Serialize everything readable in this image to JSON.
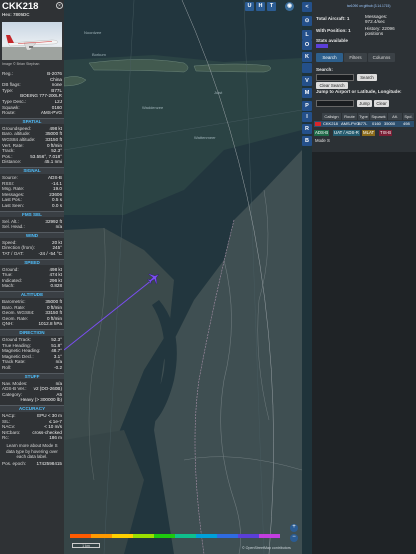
{
  "aircraft": {
    "callsign": "CKK218",
    "hex_label": "Hex: 7805DC",
    "photo_credit": "Image © Brian Stephan",
    "close_icon": "close-icon",
    "details": [
      {
        "k": "Reg.:",
        "v": "B-2076"
      },
      {
        "k": "",
        "v": "China"
      },
      {
        "k": "DB flags:",
        "v": "none"
      },
      {
        "k": "Type:",
        "v": "B77L"
      },
      {
        "k": "",
        "v": "BOEING 777-200LR"
      },
      {
        "k": "Type Desc.:",
        "v": "L2J"
      },
      {
        "k": "Squawk:",
        "v": "0160"
      },
      {
        "k": "Route:",
        "v": "AMS-PVG"
      }
    ]
  },
  "sections": {
    "spatial": {
      "title": "SPATIAL",
      "rows": [
        {
          "k": "Groundspeed:",
          "v": "498 kt"
        },
        {
          "k": "Baro. altitude:",
          "v": "35000 ft"
        },
        {
          "k": "WGS84 altitude:",
          "v": "33150 ft"
        },
        {
          "k": "Vert. Rate:",
          "v": "0 ft/min"
        },
        {
          "k": "Track:",
          "v": "52.3°"
        },
        {
          "k": "Pos.:",
          "v": "53.556°, 7.018°"
        },
        {
          "k": "Distance:",
          "v": "45.1 nmi"
        }
      ]
    },
    "signal": {
      "title": "SIGNAL",
      "rows": [
        {
          "k": "Source:",
          "v": "ADS-B"
        },
        {
          "k": "RSSI:",
          "v": "-14.1"
        },
        {
          "k": "Msg. Rate:",
          "v": "19.0"
        },
        {
          "k": "Messages:",
          "v": "23606"
        },
        {
          "k": "Last Pos.:",
          "v": "0.5 s"
        },
        {
          "k": "Last Seen:",
          "v": "0.0 s"
        }
      ]
    },
    "fms": {
      "title": "FMS SEL",
      "rows": [
        {
          "k": "Sel. Alt.:",
          "v": "32992 ft"
        },
        {
          "k": "Sel. Head.:",
          "v": "n/a"
        }
      ]
    },
    "wind": {
      "title": "WIND",
      "rows": [
        {
          "k": "Speed:",
          "v": "20 kt"
        },
        {
          "k": "Direction (from):",
          "v": "245°"
        },
        {
          "k": "TAT / OAT:",
          "v": "-24 / -54 °C"
        }
      ]
    },
    "speed": {
      "title": "SPEED",
      "rows": [
        {
          "k": "Ground:",
          "v": "498 kt"
        },
        {
          "k": "True:",
          "v": "474 kt"
        },
        {
          "k": "Indicated:",
          "v": "296 kt"
        },
        {
          "k": "Mach:",
          "v": "0.828"
        }
      ]
    },
    "altitude": {
      "title": "ALTITUDE",
      "rows": [
        {
          "k": "Barometric:",
          "v": "35000 ft"
        },
        {
          "k": "Baro. Rate:",
          "v": "0 ft/min"
        },
        {
          "k": "Geom. WGS84:",
          "v": "33150 ft"
        },
        {
          "k": "Geom. Rate:",
          "v": "0 ft/min"
        },
        {
          "k": "QNH:",
          "v": "1012.8 hPa"
        }
      ]
    },
    "direction": {
      "title": "DIRECTION",
      "rows": [
        {
          "k": "Ground Track:",
          "v": "52.3°"
        },
        {
          "k": "True Heading:",
          "v": "51.8°"
        },
        {
          "k": "Magnetic Heading:",
          "v": "48.7°"
        },
        {
          "k": "Magnetic Decl.:",
          "v": "3.1°"
        },
        {
          "k": "Track Rate:",
          "v": "n/a"
        },
        {
          "k": "Roll:",
          "v": "-0.2"
        }
      ]
    },
    "stuff": {
      "title": "STUFF",
      "rows": [
        {
          "k": "Nav. Modes:",
          "v": "n/a"
        },
        {
          "k": "ADS-B Ver.:",
          "v": "v2 (DO-260B)"
        },
        {
          "k": "Category:",
          "v": "A5"
        },
        {
          "k": "",
          "v": "Heavy (> 300000 lb)"
        }
      ]
    },
    "accuracy": {
      "title": "ACCURACY",
      "rows": [
        {
          "k": "NACp:",
          "v": "EPU < 30 m"
        },
        {
          "k": "SIL:",
          "v": "≤ 1e-7"
        },
        {
          "k": "NACv:",
          "v": "< 10 m/s"
        },
        {
          "k": "NICbaro:",
          "v": "cross-checked"
        },
        {
          "k": "Rc:",
          "v": "186 m"
        }
      ]
    },
    "learn_more": "Learn more about Mode S data type by hovering over each data label.",
    "position_epoch": {
      "k": "Pos. epoch:",
      "v": "1742598415"
    }
  },
  "map": {
    "labels": {
      "waddenzee": "Waddenzee",
      "island_a": "Borkum",
      "island_b": "Juist",
      "sea_label": "Noordzee",
      "wz2": "Wattenmeer"
    },
    "top_buttons": [
      "U",
      "H",
      "T"
    ],
    "zoom_in": "+",
    "zoom_out": "−",
    "copyright": "© OpenStreetMap contributors",
    "scale_label": "1 km",
    "altitude_scale_colors": [
      "#ff5a00",
      "#ff9900",
      "#ffd000",
      "#9ae000",
      "#1ec90e",
      "#0fbf8c",
      "#00a0d8",
      "#2f6be0",
      "#5b3fd8",
      "#c33ee0"
    ],
    "icons": {
      "aircraft": "aircraft-icon",
      "layers": "layers-icon",
      "settings": "gear-icon"
    }
  },
  "strip_buttons": [
    "<",
    "⊙",
    "L",
    "O",
    "K",
    "",
    "V",
    "M",
    "P",
    "I",
    "R",
    "B"
  ],
  "right_panel": {
    "header_link": "tar1090 on github (3.14.1715)",
    "total_label": "Total Aircraft: 1",
    "messages_label": "Messages:",
    "messages_value": "972.4/sec",
    "with_position_label": "With Position: 1",
    "history_label": "History: 22096 positions",
    "stats_label": "Stats available",
    "tabs": [
      "Search",
      "Filters",
      "Columns"
    ],
    "search_label": "Search:",
    "search_button": "Search",
    "clear_search_button": "Clear Search",
    "jump_label": "Jump to Airport or Latitude, Longitude:",
    "jump_button": "Jump",
    "clear_button": "Clear",
    "table_headers": [
      "Callsign",
      "Route",
      "Type",
      "Squawk",
      "Alt.",
      "Spd."
    ],
    "row": {
      "flag": "flag-icon",
      "callsign": "CKK218",
      "route": "AMS-PVG",
      "type": "B77L",
      "squawk": "0160",
      "alt": "35000",
      "spd": "498"
    },
    "chips": [
      "ADS-B",
      "UAT / ADS-R",
      "MLAT",
      "TIS-B"
    ],
    "mode_s": "Mode S"
  }
}
